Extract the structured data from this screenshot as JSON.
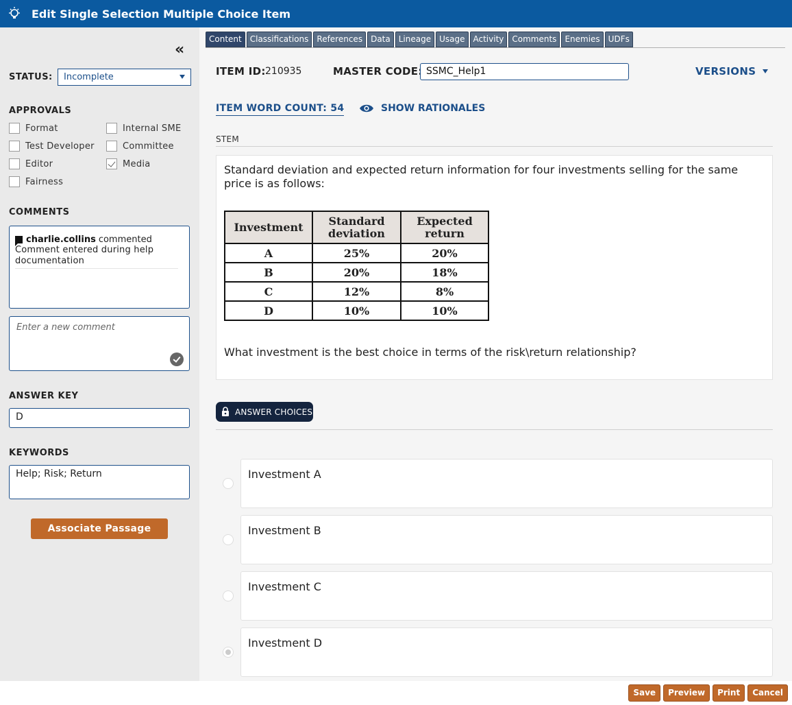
{
  "window": {
    "title": "Edit Single Selection Multiple Choice Item"
  },
  "sidebar": {
    "collapse_glyph": "«",
    "status_label": "STATUS:",
    "status_value": "Incomplete",
    "approvals_label": "APPROVALS",
    "approvals": [
      {
        "label": "Format",
        "checked": false
      },
      {
        "label": "Internal SME",
        "checked": false
      },
      {
        "label": "Test Developer",
        "checked": false
      },
      {
        "label": "Committee",
        "checked": false
      },
      {
        "label": "Editor",
        "checked": false
      },
      {
        "label": "Media",
        "checked": true
      },
      {
        "label": "Fairness",
        "checked": false
      }
    ],
    "comments_label": "COMMENTS",
    "comment": {
      "user": "charlie.collins",
      "action": "commented",
      "text": "Comment entered during help documentation"
    },
    "new_comment_placeholder": "Enter a new comment",
    "answer_key_label": "ANSWER KEY",
    "answer_key_value": "D",
    "keywords_label": "KEYWORDS",
    "keywords_value": "Help; Risk; Return",
    "associate_passage_label": "Associate Passage"
  },
  "tabs": [
    {
      "label": "Content",
      "active": true
    },
    {
      "label": "Classifications",
      "active": false
    },
    {
      "label": "References",
      "active": false
    },
    {
      "label": "Data",
      "active": false
    },
    {
      "label": "Lineage",
      "active": false
    },
    {
      "label": "Usage",
      "active": false
    },
    {
      "label": "Activity",
      "active": false
    },
    {
      "label": "Comments",
      "active": false
    },
    {
      "label": "Enemies",
      "active": false
    },
    {
      "label": "UDFs",
      "active": false
    }
  ],
  "header": {
    "item_id_label": "ITEM ID:",
    "item_id_value": "210935",
    "master_code_label": "MASTER CODE:",
    "master_code_value": "SSMC_Help1",
    "versions_label": "VERSIONS",
    "word_count_label": "ITEM WORD COUNT: 54",
    "show_rationales_label": "SHOW RATIONALES"
  },
  "stem": {
    "label": "STEM",
    "intro": "Standard deviation and expected return information for four investments selling for the same price is as follows:",
    "table": {
      "headers": [
        "Investment",
        "Standard deviation",
        "Expected return"
      ],
      "rows": [
        [
          "A",
          "25%",
          "20%"
        ],
        [
          "B",
          "20%",
          "18%"
        ],
        [
          "C",
          "12%",
          "8%"
        ],
        [
          "D",
          "10%",
          "10%"
        ]
      ]
    },
    "question": "What investment is the best choice in terms of the risk\\return relationship?"
  },
  "answers": {
    "label": "ANSWER CHOICES",
    "choices": [
      {
        "text": "Investment A",
        "selected": false
      },
      {
        "text": "Investment B",
        "selected": false
      },
      {
        "text": "Investment C",
        "selected": false
      },
      {
        "text": "Investment D",
        "selected": true
      }
    ]
  },
  "footer": {
    "save": "Save",
    "preview": "Preview",
    "print": "Print",
    "cancel": "Cancel"
  },
  "colors": {
    "titlebar": "#0b5aa0",
    "accent_blue": "#1c4f8a",
    "action_orange": "#c0692a",
    "tab_active": "#30466a",
    "tab_inactive": "#5b6f87"
  }
}
